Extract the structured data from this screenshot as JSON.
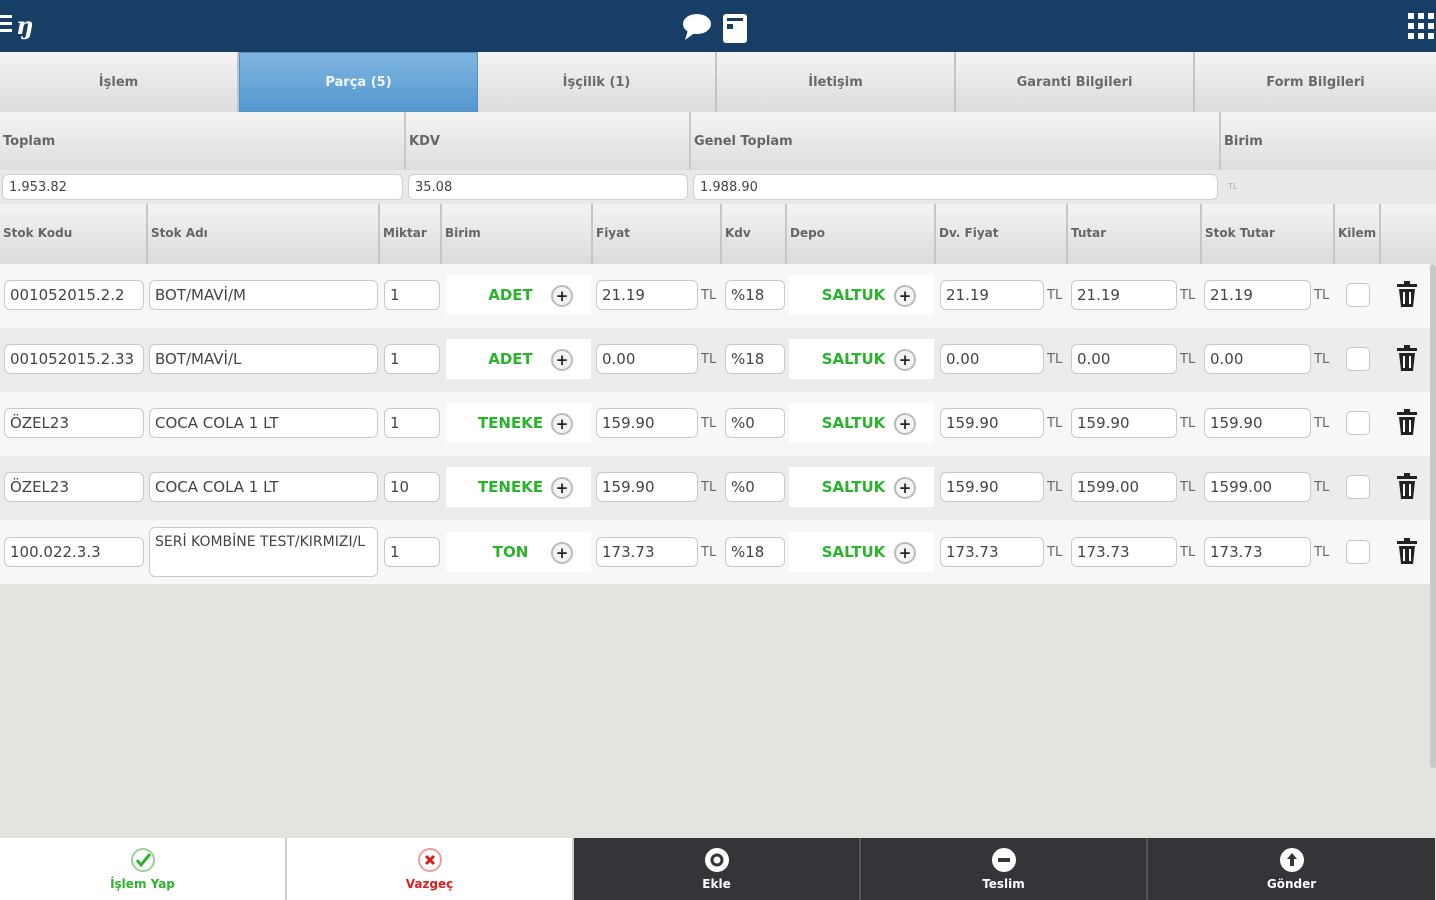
{
  "app": {
    "logo": "ŋ"
  },
  "tabs": [
    {
      "label": "İşlem"
    },
    {
      "label": "Parça (5)",
      "active": true
    },
    {
      "label": "İşçilik (1)"
    },
    {
      "label": "İletişim"
    },
    {
      "label": "Garanti Bilgileri"
    },
    {
      "label": "Form Bilgileri"
    }
  ],
  "summary": {
    "toplam_label": "Toplam",
    "toplam_value": "1.953.82",
    "kdv_label": "KDV",
    "kdv_value": "35.08",
    "genel_label": "Genel Toplam",
    "genel_value": "1.988.90",
    "birim_label": "Birim",
    "birim_value": "TL"
  },
  "columns": {
    "stok_kodu": "Stok Kodu",
    "stok_adi": "Stok Adı",
    "miktar": "Miktar",
    "birim": "Birim",
    "fiyat": "Fiyat",
    "kdv": "Kdv",
    "depo": "Depo",
    "dv_fiyat": "Dv. Fiyat",
    "tutar": "Tutar",
    "stok_tutar": "Stok Tutar",
    "kilem": "Kilem"
  },
  "currency": "TL",
  "rows": [
    {
      "kod": "001052015.2.2",
      "ad": "BOT/MAVİ/M",
      "miktar": "1",
      "birim": "ADET",
      "fiyat": "21.19",
      "kdv": "%18",
      "depo": "SALTUK",
      "dv_fiyat": "21.19",
      "tutar": "21.19",
      "stok_tutar": "21.19"
    },
    {
      "kod": "001052015.2.33",
      "ad": "BOT/MAVİ/L",
      "miktar": "1",
      "birim": "ADET",
      "fiyat": "0.00",
      "kdv": "%18",
      "depo": "SALTUK",
      "dv_fiyat": "0.00",
      "tutar": "0.00",
      "stok_tutar": "0.00"
    },
    {
      "kod": "ÖZEL23",
      "ad": "COCA COLA 1 LT",
      "miktar": "1",
      "birim": "TENEKE",
      "fiyat": "159.90",
      "kdv": "%0",
      "depo": "SALTUK",
      "dv_fiyat": "159.90",
      "tutar": "159.90",
      "stok_tutar": "159.90"
    },
    {
      "kod": "ÖZEL23",
      "ad": "COCA COLA 1 LT",
      "miktar": "10",
      "birim": "TENEKE",
      "fiyat": "159.90",
      "kdv": "%0",
      "depo": "SALTUK",
      "dv_fiyat": "159.90",
      "tutar": "1599.00",
      "stok_tutar": "1599.00"
    },
    {
      "kod": "100.022.3.3",
      "ad": "SERİ KOMBİNE TEST/KIRMIZI/L",
      "miktar": "1",
      "birim": "TON",
      "fiyat": "173.73",
      "kdv": "%18",
      "depo": "SALTUK",
      "dv_fiyat": "173.73",
      "tutar": "173.73",
      "stok_tutar": "173.73"
    }
  ],
  "bottom": {
    "islem_yap": "İşlem Yap",
    "vazgec": "Vazgeç",
    "ekle": "Ekle",
    "teslim": "Teslim",
    "gonder": "Gönder"
  },
  "colors": {
    "topbar": "#173f66",
    "active_tab": "#5598d0",
    "green": "#2bb32b",
    "red": "#d82020",
    "dark": "#333539"
  }
}
